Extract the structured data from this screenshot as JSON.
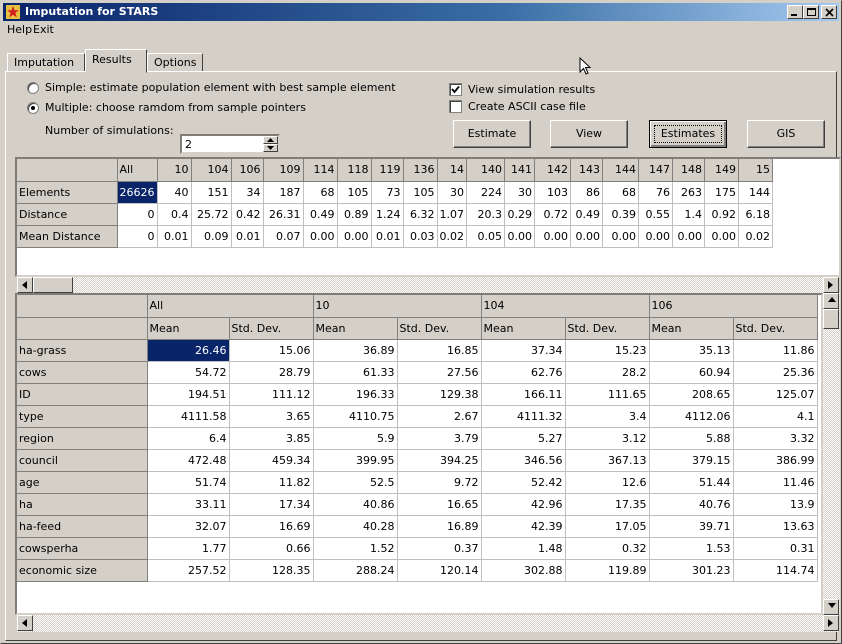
{
  "window": {
    "title": "Imputation for STARS",
    "icon": "star-app-icon"
  },
  "menu": [
    {
      "label": "Help",
      "accel": "H"
    },
    {
      "label": "Exit",
      "accel": "E"
    }
  ],
  "tabs": [
    {
      "label": "Imputation",
      "active": false
    },
    {
      "label": "Results",
      "active": true
    },
    {
      "label": "Options",
      "active": false
    }
  ],
  "options": {
    "simple_label": "Simple: estimate population element with best sample element",
    "multiple_label": "Multiple: choose ramdom from sample pointers",
    "selected": "multiple",
    "num_sim_label": "Number of simulations:",
    "num_sim_value": "2",
    "view_sim_label": "View simulation results",
    "view_sim_checked": true,
    "ascii_label": "Create ASCII case file",
    "ascii_checked": false
  },
  "buttons": {
    "estimate": "Estimate",
    "view": "View",
    "estimates": "Estimates",
    "gis": "GIS"
  },
  "top_grid": {
    "columns": [
      "",
      "All",
      "10",
      "104",
      "106",
      "109",
      "114",
      "118",
      "119",
      "136",
      "14",
      "140",
      "141",
      "142",
      "143",
      "144",
      "147",
      "148",
      "149",
      "15"
    ],
    "rows": [
      [
        "Elements",
        "26626",
        "40",
        "151",
        "34",
        "187",
        "68",
        "105",
        "73",
        "105",
        "30",
        "224",
        "30",
        "103",
        "86",
        "68",
        "76",
        "263",
        "175",
        "144"
      ],
      [
        "Distance",
        "0",
        "0.4",
        "25.72",
        "0.42",
        "26.31",
        "0.49",
        "0.89",
        "1.24",
        "6.32",
        "1.07",
        "20.3",
        "0.29",
        "0.72",
        "0.49",
        "0.39",
        "0.55",
        "1.4",
        "0.92",
        "6.18"
      ],
      [
        "Mean Distance",
        "0",
        "0.01",
        "0.09",
        "0.01",
        "0.07",
        "0.00",
        "0.00",
        "0.01",
        "0.03",
        "0.02",
        "0.05",
        "0.00",
        "0.00",
        "0.00",
        "0.00",
        "0.00",
        "0.00",
        "0.00",
        "0.02"
      ]
    ]
  },
  "bottom_grid": {
    "groups": [
      "All",
      "10",
      "104",
      "106"
    ],
    "subheaders": [
      "Mean",
      "Std. Dev.",
      "Mean",
      "Std. Dev.",
      "Mean",
      "Std. Dev.",
      "Mean",
      "Std. Dev."
    ],
    "rows": [
      [
        "ha-grass",
        "26.46",
        "15.06",
        "36.89",
        "16.85",
        "37.34",
        "15.23",
        "35.13",
        "11.86"
      ],
      [
        "cows",
        "54.72",
        "28.79",
        "61.33",
        "27.56",
        "62.76",
        "28.2",
        "60.94",
        "25.36"
      ],
      [
        "ID",
        "194.51",
        "111.12",
        "196.33",
        "129.38",
        "166.11",
        "111.65",
        "208.65",
        "125.07"
      ],
      [
        "type",
        "4111.58",
        "3.65",
        "4110.75",
        "2.67",
        "4111.32",
        "3.4",
        "4112.06",
        "4.1"
      ],
      [
        "region",
        "6.4",
        "3.85",
        "5.9",
        "3.79",
        "5.27",
        "3.12",
        "5.88",
        "3.32"
      ],
      [
        "council",
        "472.48",
        "459.34",
        "399.95",
        "394.25",
        "346.56",
        "367.13",
        "379.15",
        "386.99"
      ],
      [
        "age",
        "51.74",
        "11.82",
        "52.5",
        "9.72",
        "52.42",
        "12.6",
        "51.44",
        "11.46"
      ],
      [
        "ha",
        "33.11",
        "17.34",
        "40.86",
        "16.65",
        "42.96",
        "17.35",
        "40.76",
        "13.9"
      ],
      [
        "ha-feed",
        "32.07",
        "16.69",
        "40.28",
        "16.89",
        "42.39",
        "17.05",
        "39.71",
        "13.63"
      ],
      [
        "cowsperha",
        "1.77",
        "0.66",
        "1.52",
        "0.37",
        "1.48",
        "0.32",
        "1.53",
        "0.31"
      ],
      [
        "economic size",
        "257.52",
        "128.35",
        "288.24",
        "120.14",
        "302.88",
        "119.89",
        "301.23",
        "114.74"
      ]
    ]
  }
}
